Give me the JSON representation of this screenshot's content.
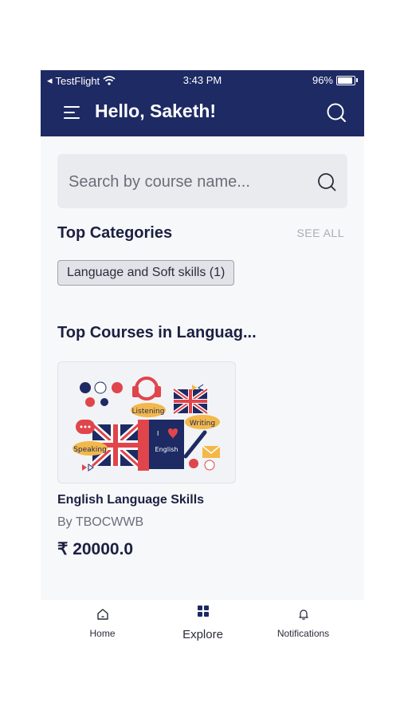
{
  "status_bar": {
    "carrier": "TestFlight",
    "time": "3:43 PM",
    "battery": "96%"
  },
  "header": {
    "greeting": "Hello, Saketh!",
    "menu_icon": "menu-icon",
    "search_icon": "search-icon"
  },
  "search": {
    "placeholder": "Search by course name..."
  },
  "categories": {
    "title": "Top Categories",
    "see_all": "SEE ALL",
    "items": [
      {
        "label": "Language and Soft skills (1)"
      }
    ]
  },
  "courses_section": {
    "title": "Top Courses in Languag...",
    "courses": [
      {
        "title": "English Language Skills",
        "author": "By TBOCWWB",
        "price": "₹ 20000.0",
        "image_labels": {
          "listening": "Listening",
          "writing": "Writing",
          "speaking": "Speaking"
        }
      }
    ]
  },
  "bottom_nav": {
    "items": [
      {
        "label": "Home",
        "icon": "home-icon"
      },
      {
        "label": "Explore",
        "icon": "grid-icon",
        "active": true
      },
      {
        "label": "Notifications",
        "icon": "bell-icon"
      }
    ]
  },
  "colors": {
    "header": "#1d2a63",
    "background": "#f7f8fa",
    "text_dark": "#1c2040",
    "muted": "#a8acb5"
  }
}
